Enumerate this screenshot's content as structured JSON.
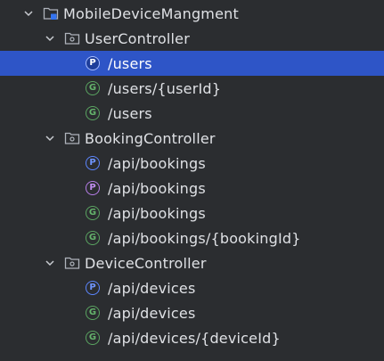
{
  "root": {
    "label": "MobileDeviceMangment",
    "icon": "module-folder-icon",
    "expanded": true
  },
  "controllers": [
    {
      "label": "UserController",
      "expanded": true,
      "endpoints": [
        {
          "method_icon": "P",
          "method": "post",
          "path": "/users",
          "selected": true
        },
        {
          "method_icon": "G",
          "method": "get",
          "path": "/users/{userId}",
          "selected": false
        },
        {
          "method_icon": "G",
          "method": "get",
          "path": "/users",
          "selected": false
        }
      ]
    },
    {
      "label": "BookingController",
      "expanded": true,
      "endpoints": [
        {
          "method_icon": "P",
          "method": "post",
          "path": "/api/bookings",
          "selected": false
        },
        {
          "method_icon": "P",
          "method": "put",
          "path": "/api/bookings",
          "selected": false
        },
        {
          "method_icon": "G",
          "method": "get",
          "path": "/api/bookings",
          "selected": false
        },
        {
          "method_icon": "G",
          "method": "get",
          "path": "/api/bookings/{bookingId}",
          "selected": false
        }
      ]
    },
    {
      "label": "DeviceController",
      "expanded": true,
      "endpoints": [
        {
          "method_icon": "P",
          "method": "post",
          "path": "/api/devices",
          "selected": false
        },
        {
          "method_icon": "G",
          "method": "get",
          "path": "/api/devices",
          "selected": false
        },
        {
          "method_icon": "G",
          "method": "get",
          "path": "/api/devices/{deviceId}",
          "selected": false
        }
      ]
    }
  ],
  "colors": {
    "background": "#2b2d30",
    "selection": "#2e55c7",
    "text": "#dfe1e5",
    "post": "#5c86ff",
    "put": "#b67ee8",
    "get": "#5aa461"
  }
}
